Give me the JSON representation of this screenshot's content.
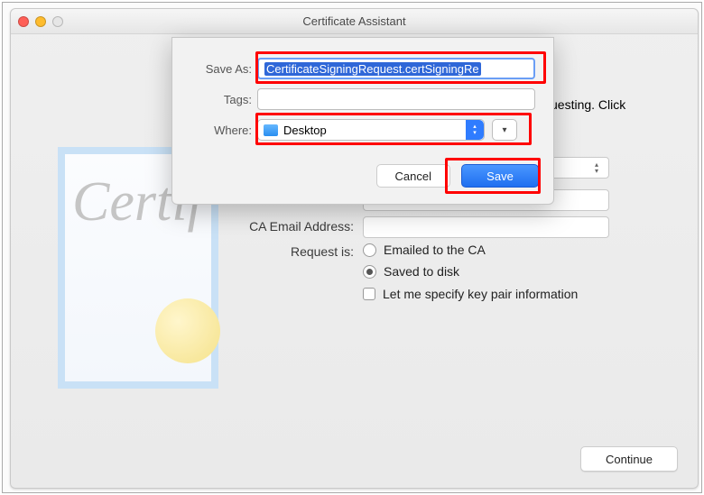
{
  "window": {
    "title": "Certificate Assistant"
  },
  "background": {
    "truncated_text": "uesting. Click",
    "labels": {
      "ca_email": "CA Email Address:",
      "request_is": "Request is:"
    },
    "options": {
      "emailed": "Emailed to the CA",
      "saved": "Saved to disk",
      "specify": "Let me specify key pair information"
    },
    "request_is_selected": "saved",
    "continue": "Continue"
  },
  "sheet": {
    "labels": {
      "save_as": "Save As:",
      "tags": "Tags:",
      "where": "Where:"
    },
    "save_as_value": "CertificateSigningRequest.certSigningRe",
    "tags_value": "",
    "where_value": "Desktop",
    "buttons": {
      "cancel": "Cancel",
      "save": "Save"
    }
  },
  "cert_art": {
    "script": "Certif"
  }
}
